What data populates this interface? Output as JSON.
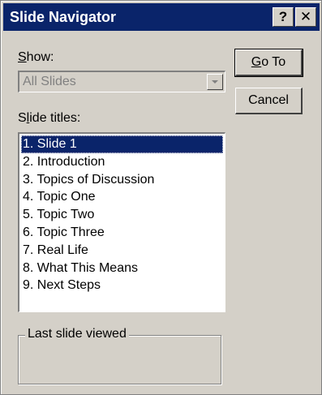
{
  "window": {
    "title": "Slide Navigator",
    "help_button": "?",
    "close_button": "✕"
  },
  "show": {
    "label_accel": "S",
    "label_rest": "how:",
    "selected_value": "All Slides"
  },
  "buttons": {
    "goto_accel": "G",
    "goto_rest": "o To",
    "cancel_label": "Cancel"
  },
  "slide_titles": {
    "label_first": "S",
    "label_accel": "l",
    "label_rest": "ide titles:",
    "items": [
      "1. Slide 1",
      "2. Introduction",
      "3. Topics of Discussion",
      "4. Topic One",
      "5. Topic Two",
      "6. Topic Three",
      "7. Real Life",
      "8. What This Means",
      "9. Next Steps"
    ],
    "selected_index": 0
  },
  "last_viewed": {
    "legend": "Last slide viewed"
  },
  "colors": {
    "face": "#d4d0c8",
    "titlebar": "#0a246a",
    "selection": "#0a246a"
  }
}
